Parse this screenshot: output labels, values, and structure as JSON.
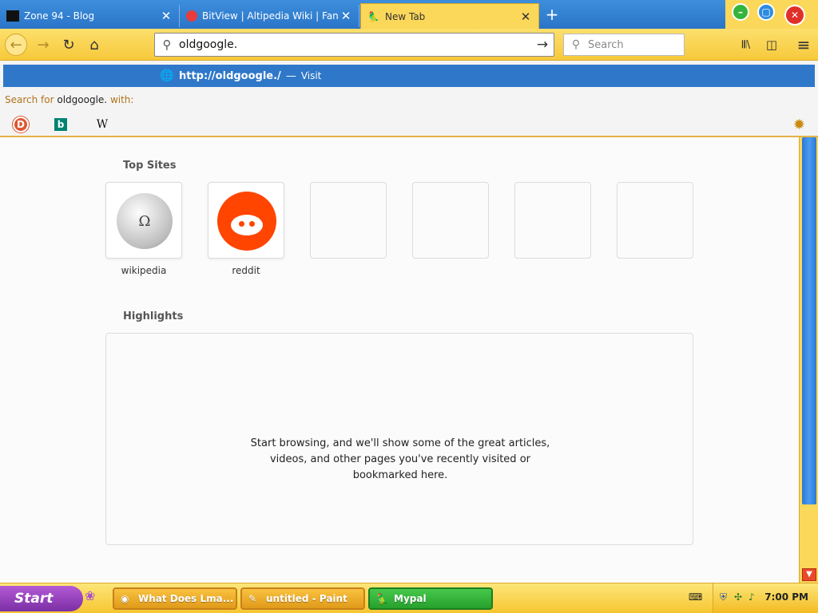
{
  "tabs": [
    {
      "title": "Zone 94 - Blog",
      "icon": "zone94-favicon"
    },
    {
      "title": "BitView | Altipedia Wiki | Fan",
      "icon": "bitview-favicon"
    },
    {
      "title": "New Tab",
      "icon": "mypal-favicon",
      "active": true
    }
  ],
  "new_tab_symbol": "+",
  "close_symbol": "✕",
  "window_buttons": {
    "minimize": "–",
    "restore": "▢",
    "close": "✕"
  },
  "nav": {
    "back": "←",
    "forward": "→",
    "reload": "↻",
    "home": "⌂",
    "url_value": "oldgoogle.",
    "go": "→",
    "search_placeholder": "Search",
    "library": "𝄃𝄃\\",
    "sidebar": "◫",
    "menu": "≡"
  },
  "suggestion": {
    "visit_url": "http://oldgoogle./",
    "dash": "—",
    "visit_label": "Visit",
    "search_prefix": "Search for",
    "search_query": "oldgoogle.",
    "search_suffix": "with:",
    "engines": [
      {
        "name": "DuckDuckGo",
        "glyph": "D"
      },
      {
        "name": "Bing",
        "glyph": "b"
      },
      {
        "name": "Wikipedia",
        "glyph": "W"
      }
    ],
    "settings": "✹"
  },
  "content": {
    "top_sites_heading": "Top Sites",
    "top_sites": [
      {
        "label": "wikipedia",
        "icon": "wikipedia-globe-icon"
      },
      {
        "label": "reddit",
        "icon": "reddit-alien-icon"
      },
      {
        "label": ""
      },
      {
        "label": ""
      },
      {
        "label": ""
      },
      {
        "label": ""
      }
    ],
    "highlights_heading": "Highlights",
    "highlights_empty": "Start browsing, and we'll show some of the great articles, videos, and other pages you've recently visited or bookmarked here."
  },
  "taskbar": {
    "start_label": "Start",
    "tasks": [
      {
        "label": "What Does Lma...",
        "icon": "chrome-icon"
      },
      {
        "label": "untitled - Paint",
        "icon": "paint-icon"
      },
      {
        "label": "Mypal",
        "icon": "mypal-icon"
      }
    ],
    "clock": "7:00 PM"
  },
  "colors": {
    "tabbar": "#2a74c8",
    "navbar": "#f7c93b",
    "visit_row": "#2f78c9",
    "taskbar": "#f6c631",
    "start_button": "#7b2fa5",
    "reddit": "#ff4500"
  }
}
